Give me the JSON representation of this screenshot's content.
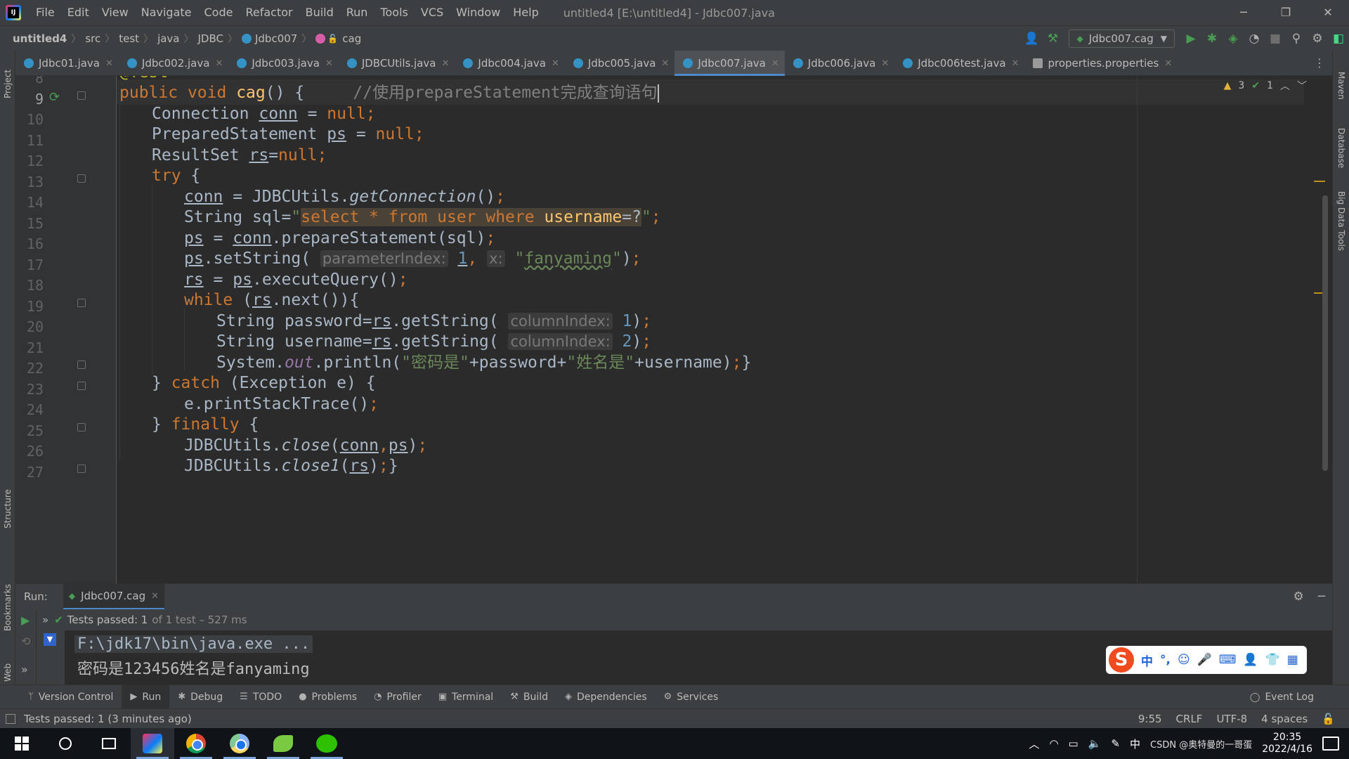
{
  "menubar": {
    "items": [
      "File",
      "Edit",
      "View",
      "Navigate",
      "Code",
      "Refactor",
      "Build",
      "Run",
      "Tools",
      "VCS",
      "Window",
      "Help"
    ],
    "window_title": "untitled4 [E:\\untitled4] - Jdbc007.java"
  },
  "breadcrumb": {
    "project": "untitled4",
    "parts": [
      "src",
      "test",
      "java",
      "JDBC"
    ],
    "class": "Jdbc007",
    "method": "cag"
  },
  "toolbar": {
    "run_config": "Jdbc007.cag"
  },
  "tabs": [
    {
      "label": "Jdbc01.java",
      "active": false
    },
    {
      "label": "Jdbc002.java",
      "active": false
    },
    {
      "label": "Jdbc003.java",
      "active": false
    },
    {
      "label": "JDBCUtils.java",
      "active": false
    },
    {
      "label": "Jdbc004.java",
      "active": false
    },
    {
      "label": "Jdbc005.java",
      "active": false
    },
    {
      "label": "Jdbc007.java",
      "active": true
    },
    {
      "label": "Jdbc006.java",
      "active": false
    },
    {
      "label": "Jdbc006test.java",
      "active": false
    },
    {
      "label": "properties.properties",
      "active": false
    }
  ],
  "left_strip": {
    "project": "Project",
    "structure": "Structure",
    "bookmarks": "Bookmarks",
    "web": "Web"
  },
  "right_strip": {
    "maven": "Maven",
    "database": "Database",
    "bigdata": "Big Data Tools"
  },
  "inspections": {
    "warnings": "3",
    "ok": "1"
  },
  "editor": {
    "line_numbers": [
      "8",
      "9",
      "10",
      "11",
      "12",
      "13",
      "14",
      "15",
      "16",
      "17",
      "18",
      "19",
      "20",
      "21",
      "22",
      "23",
      "24",
      "25",
      "26",
      "27"
    ],
    "current_line": "9",
    "strings": {
      "annotation": "@Test",
      "kw_public": "public",
      "kw_void": "void",
      "method_name": "cag",
      "sig_rest": "() {",
      "comment": "//使用prepareStatement完成查询语句",
      "connection": "Connection",
      "conn": "conn",
      "prepared": "PreparedStatement",
      "ps": "ps",
      "resultset": "ResultSet",
      "rs": "rs",
      "null": "null",
      "try": "try",
      "jdbcutils": "JDBCUtils",
      "getconn": "getConnection",
      "string": "String",
      "sql_var": "sql",
      "sql_select": "select",
      "sql_star": " * ",
      "sql_from": "from",
      "sql_user": " user ",
      "sql_where": "where",
      "sql_username": "username",
      "sql_eq": "=?",
      "prepare": "prepareStatement",
      "setstring": "setString",
      "hint_param": "parameterIndex:",
      "one": "1",
      "hint_x": "x:",
      "fanyaming": "fanyaming",
      "execq": "executeQuery",
      "while": "while",
      "next": "next",
      "password_var": "password",
      "username_var": "username",
      "getstring": "getString",
      "hint_col": "columnIndex:",
      "two": "2",
      "system": "System",
      "out": "out",
      "println": "println",
      "str_pwd": "密码是",
      "str_name": "姓名是",
      "catch": "catch",
      "exception": "Exception",
      "e": "e",
      "printst": "printStackTrace",
      "finally": "finally",
      "close": "close",
      "close1": "close1"
    }
  },
  "run_panel": {
    "label": "Run:",
    "tab": "Jdbc007.cag",
    "status_passed": "Tests passed: 1",
    "status_detail": "of 1 test – 527 ms",
    "console": [
      "F:\\jdk17\\bin\\java.exe ...",
      "密码是123456姓名是fanyaming"
    ]
  },
  "ime": {
    "logo": "S",
    "items": [
      "中",
      "°,",
      "☺",
      "🎤",
      "⌨",
      "👤",
      "👕",
      "▦"
    ]
  },
  "tool_windows": [
    {
      "label": "Version Control",
      "icon": "branch-icon"
    },
    {
      "label": "Run",
      "icon": "run-icon"
    },
    {
      "label": "Debug",
      "icon": "debug-icon"
    },
    {
      "label": "TODO",
      "icon": "todo-icon"
    },
    {
      "label": "Problems",
      "icon": "problems-icon"
    },
    {
      "label": "Profiler",
      "icon": "profiler-icon"
    },
    {
      "label": "Terminal",
      "icon": "terminal-icon"
    },
    {
      "label": "Build",
      "icon": "build-icon"
    },
    {
      "label": "Dependencies",
      "icon": "dependencies-icon"
    },
    {
      "label": "Services",
      "icon": "services-icon"
    }
  ],
  "event_log": "Event Log",
  "statusbar": {
    "message": "Tests passed: 1 (3 minutes ago)",
    "position": "9:55",
    "line_sep": "CRLF",
    "encoding": "UTF-8",
    "indent": "4 spaces"
  },
  "taskbar": {
    "time": "20:35",
    "date": "2022/4/16",
    "ime_lang": "中",
    "watermark": "CSDN @奥特曼的一哥蛋"
  },
  "colors": {
    "accent": "#4a88c7",
    "keyword": "#cc7832",
    "string": "#6a8759",
    "function": "#ffc66d",
    "number": "#6897bb"
  }
}
